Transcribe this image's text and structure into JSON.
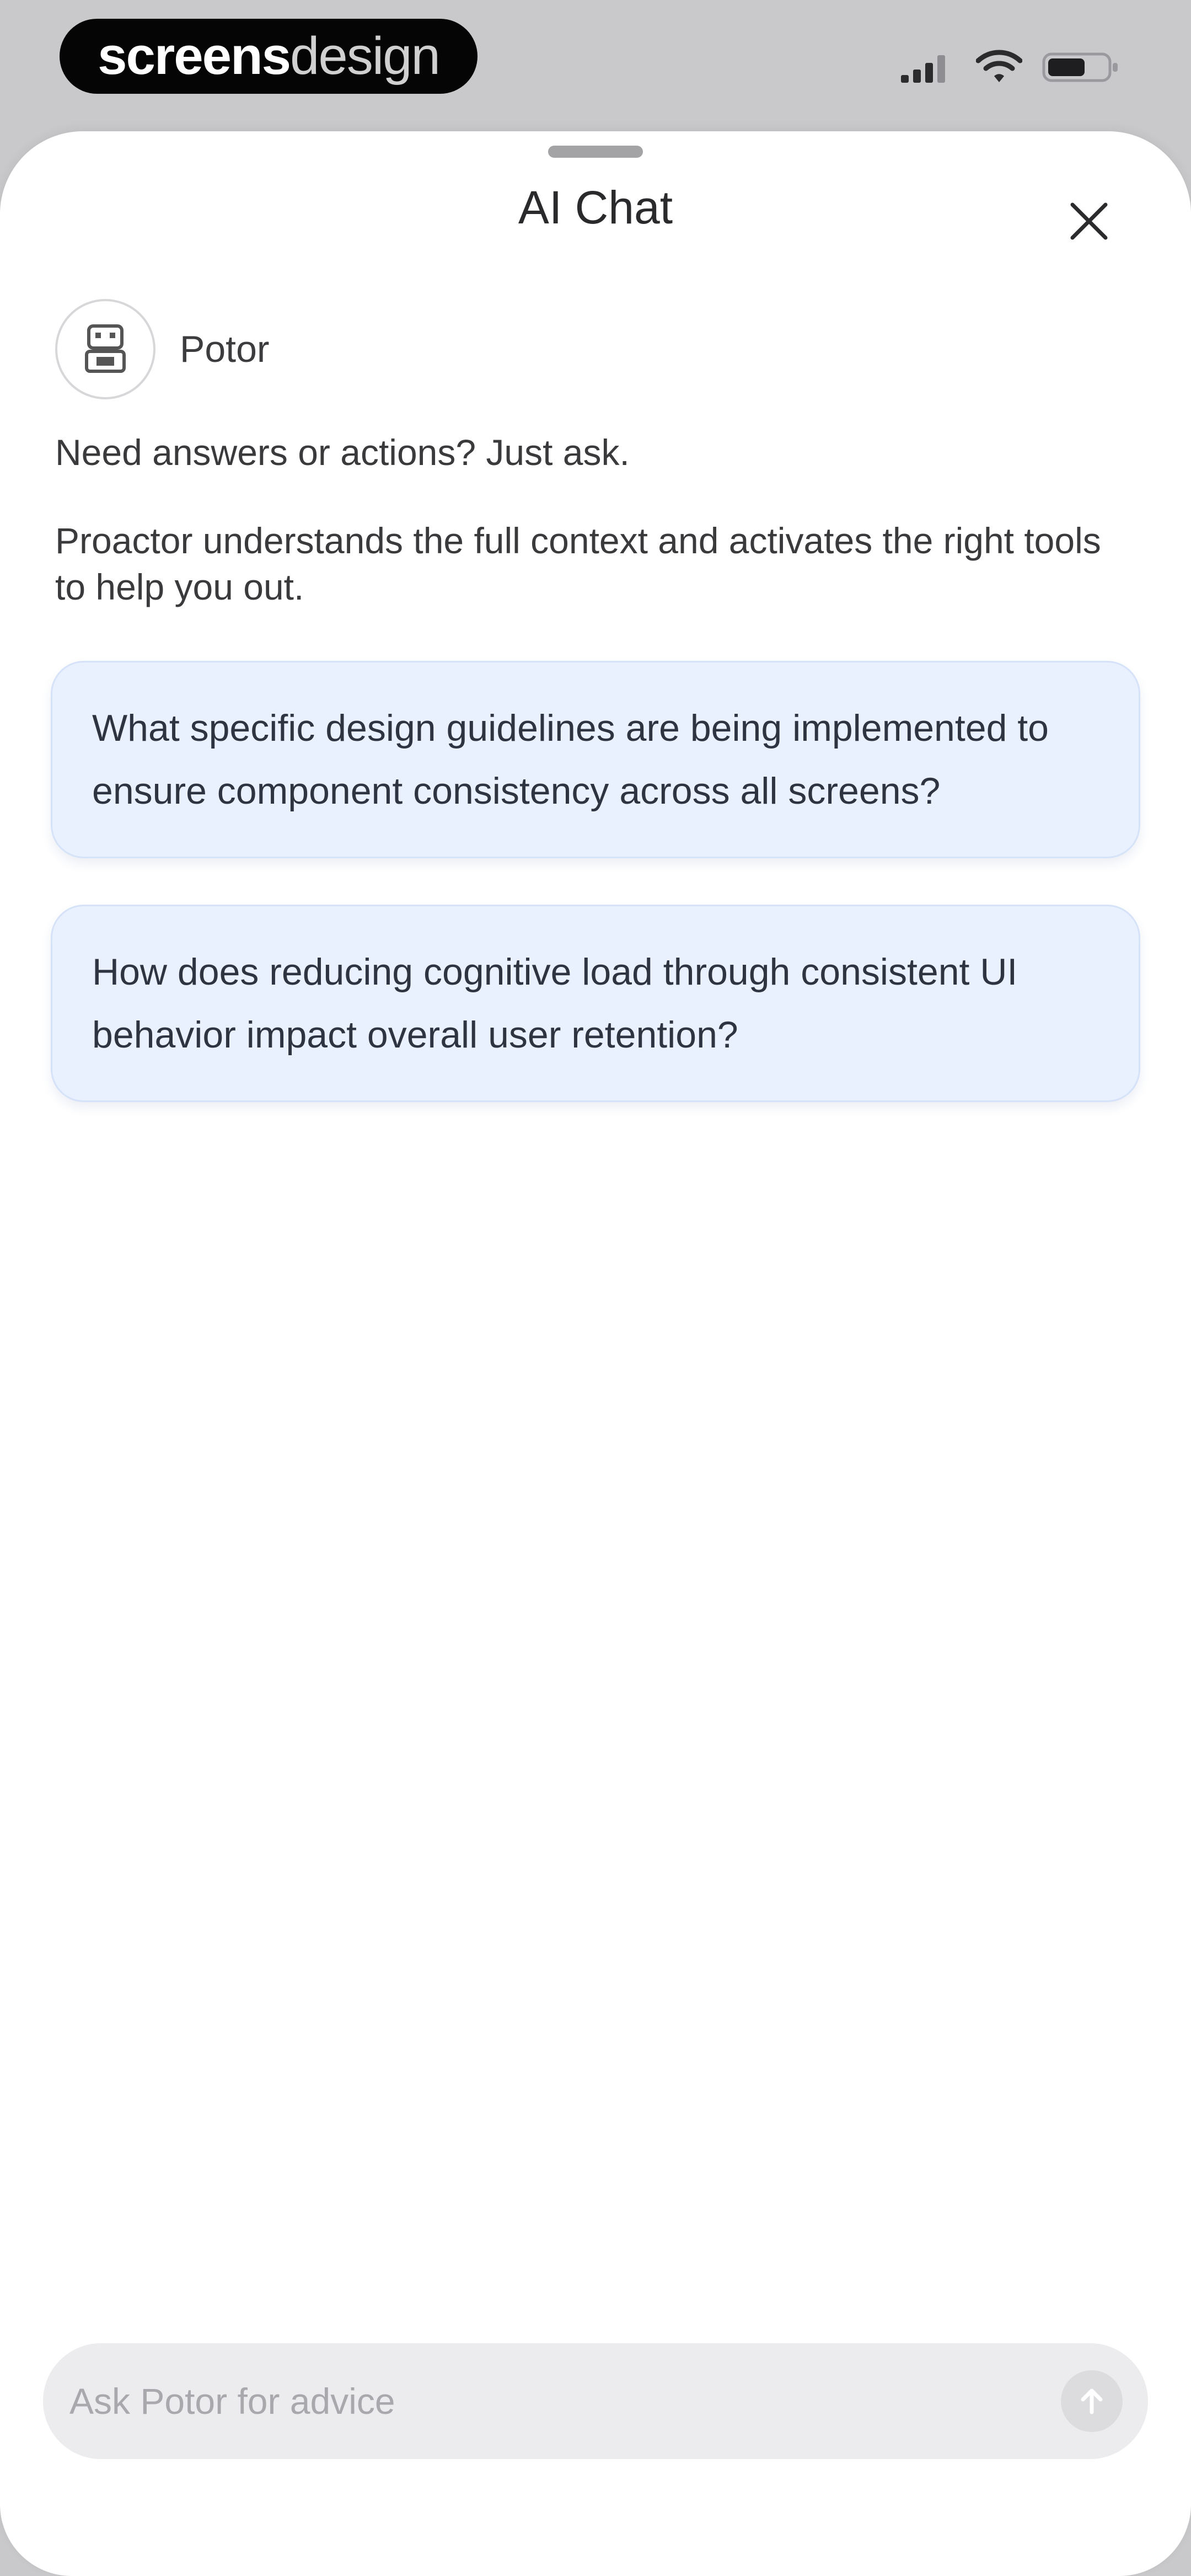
{
  "status_bar": {
    "brand_bold": "screens",
    "brand_light": "design",
    "icons": [
      "cellular-signal-icon",
      "wifi-icon",
      "battery-icon"
    ]
  },
  "sheet": {
    "title": "AI Chat",
    "close_icon": "close-icon"
  },
  "assistant": {
    "name": "Potor",
    "avatar_icon": "robot-icon"
  },
  "intro": {
    "line1": "Need answers or actions? Just ask.",
    "line2": "Proactor understands the full context and activates the right tools to help you out."
  },
  "suggestions": [
    {
      "text": "What specific design guidelines are being implemented to ensure component consistency across all screens?"
    },
    {
      "text": "How does reducing cognitive load through consistent UI behavior impact overall user retention?"
    }
  ],
  "composer": {
    "placeholder": "Ask Potor for advice",
    "value": "",
    "send_icon": "arrow-up-icon"
  },
  "colors": {
    "suggestion_bg": "#e9f1fe",
    "sheet_bg": "#ffffff",
    "status_bg": "#c9c9cb",
    "input_bg": "#ececee"
  }
}
